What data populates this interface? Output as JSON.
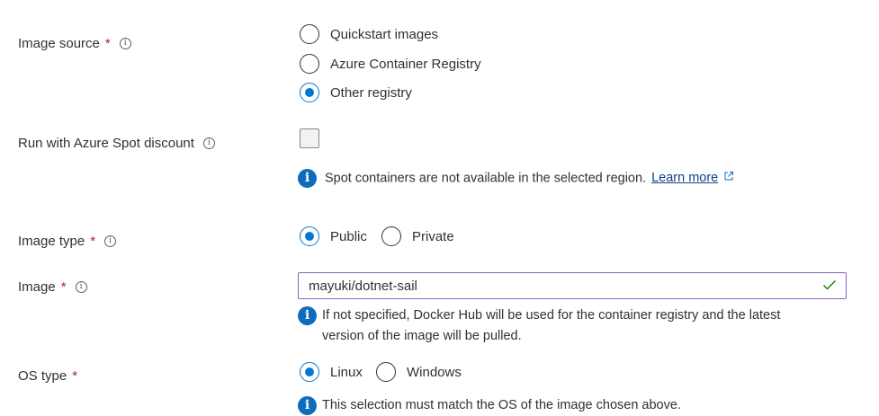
{
  "image_source": {
    "label": "Image source",
    "required_mark": "*",
    "info_icon": "info-icon",
    "options": [
      {
        "label": "Quickstart images",
        "checked": false
      },
      {
        "label": "Azure Container Registry",
        "checked": false
      },
      {
        "label": "Other registry",
        "checked": true
      }
    ]
  },
  "spot": {
    "label": "Run with Azure Spot discount",
    "info_icon": "info-icon",
    "checked": false,
    "message": "Spot containers are not available in the selected region.",
    "link_label": "Learn more",
    "link_icon": "external-link-icon"
  },
  "image_type": {
    "label": "Image type",
    "required_mark": "*",
    "info_icon": "info-icon",
    "options": [
      {
        "label": "Public",
        "checked": true
      },
      {
        "label": "Private",
        "checked": false
      }
    ]
  },
  "image": {
    "label": "Image",
    "required_mark": "*",
    "info_icon": "info-icon",
    "value": "mayuki/dotnet-sail",
    "valid_icon": "checkmark-icon",
    "message_line1": "If not specified, Docker Hub will be used for the container registry and the latest",
    "message_line2": "version of the image will be pulled."
  },
  "os_type": {
    "label": "OS type",
    "required_mark": "*",
    "options": [
      {
        "label": "Linux",
        "checked": true
      },
      {
        "label": "Windows",
        "checked": false
      }
    ],
    "message": "This selection must match the OS of the image chosen above."
  },
  "colors": {
    "accent": "#0078d4",
    "required": "#a4262c",
    "valid_check": "#107c10",
    "focused_border": "#8661c5"
  }
}
